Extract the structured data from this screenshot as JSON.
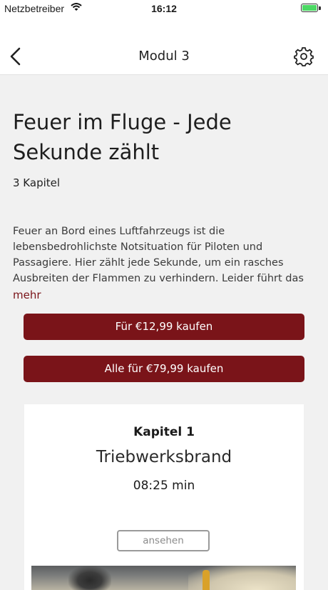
{
  "status_bar": {
    "carrier": "Netzbetreiber",
    "time": "16:12",
    "wifi_icon": "wifi-icon",
    "battery_icon": "battery-icon",
    "battery_color": "#4cd964"
  },
  "nav": {
    "title": "Modul 3",
    "back_icon": "chevron-left-icon",
    "settings_icon": "gear-icon"
  },
  "module": {
    "title": "Feuer im Fluge - Jede Sekunde zählt",
    "chapter_count": "3 Kapitel",
    "description": "Feuer an Bord eines Luftfahrzeugs ist die lebensbedrohlichste Notsituation für Piloten und Passagiere. Hier zählt jede Sekunde, um ein rasches Ausbreiten der Flammen zu verhindern. Leider führt das fehlende Bewusstsein über Feu…",
    "more_label": "mehr"
  },
  "purchase": {
    "single_label": "Für €12,99 kaufen",
    "all_label": "Alle für €79,99 kaufen",
    "accent_color": "#7a1419"
  },
  "chapter_card": {
    "chapter_label": "Kapitel 1",
    "title": "Triebwerksbrand",
    "duration": "08:25 min",
    "view_label": "ansehen"
  }
}
